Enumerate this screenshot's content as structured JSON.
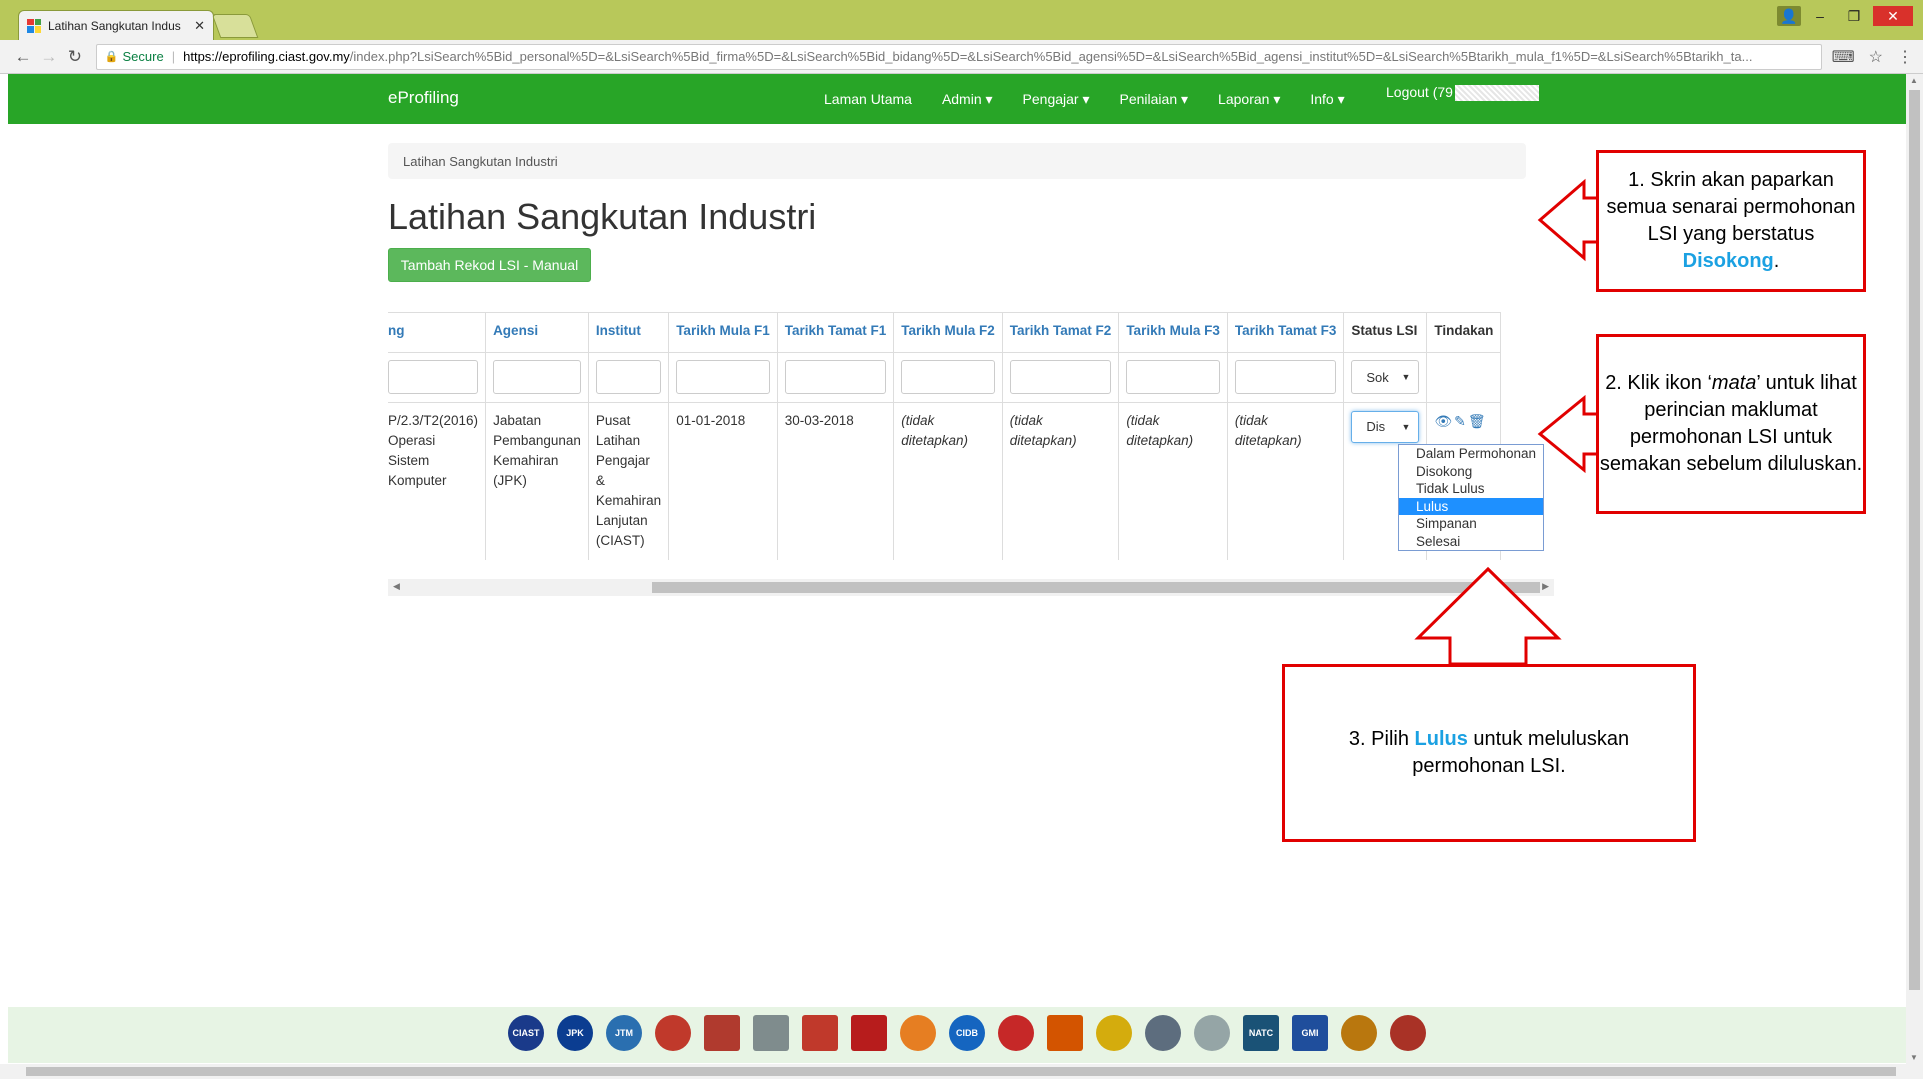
{
  "browser": {
    "tab_title": "Latihan Sangkutan Indus",
    "tab_close": "✕",
    "secure_label": "Secure",
    "url_host": "https://eprofiling.ciast.gov.my",
    "url_path": "/index.php?LsiSearch%5Bid_personal%5D=&LsiSearch%5Bid_firma%5D=&LsiSearch%5Bid_bidang%5D=&LsiSearch%5Bid_agensi%5D=&LsiSearch%5Bid_agensi_institut%5D=&LsiSearch%5Btarikh_mula_f1%5D=&LsiSearch%5Btarikh_ta..."
  },
  "navbar": {
    "brand": "eProfiling",
    "menu": [
      "Laman Utama",
      "Admin ▾",
      "Pengajar ▾",
      "Penilaian ▾",
      "Laporan ▾",
      "Info ▾"
    ],
    "logout": "Logout (79"
  },
  "breadcrumb": "Latihan Sangkutan Industri",
  "page_title": "Latihan Sangkutan Industri",
  "add_button": "Tambah Rekod LSI - Manual",
  "table": {
    "headers": [
      "ng",
      "Agensi",
      "Institut",
      "Tarikh Mula F1",
      "Tarikh Tamat F1",
      "Tarikh Mula F2",
      "Tarikh Tamat F2",
      "Tarikh Mula F3",
      "Tarikh Tamat F3",
      "Status LSI",
      "Tindakan"
    ],
    "filter_status": "Sok",
    "row": {
      "bidang": "P/2.3/T2(2016) Operasi Sistem Komputer",
      "agensi": "Jabatan Pembangunan Kemahiran (JPK)",
      "institut": "Pusat Latihan Pengajar & Kemahiran Lanjutan (CIAST)",
      "mula_f1": "01-01-2018",
      "tamat_f1": "30-03-2018",
      "mula_f2": "(tidak ditetapkan)",
      "tamat_f2": "(tidak ditetapkan)",
      "mula_f3": "(tidak ditetapkan)",
      "tamat_f3": "(tidak ditetapkan)",
      "status": "Dis"
    }
  },
  "status_options": [
    "Dalam Permohonan",
    "Disokong",
    "Tidak Lulus",
    "Lulus",
    "Simpanan",
    "Selesai"
  ],
  "status_selected_index": 3,
  "callouts": {
    "c1_text": "1. Skrin akan paparkan semua senarai permohonan LSI yang berstatus",
    "c1_hl": "Disokong",
    "c2_pre": "2. Klik ikon ‘",
    "c2_em": "mata",
    "c2_post": "’ untuk lihat perincian maklumat permohonan LSI untuk semakan sebelum diluluskan.",
    "c3_pre": "3. Pilih",
    "c3_hl": "Lulus",
    "c3_post": "untuk meluluskan permohonan LSI."
  },
  "colors": {
    "navbar": "#28a527",
    "button": "#5cb85c",
    "link": "#337ab7",
    "not_set": "#d9534f",
    "callout_border": "#e10000",
    "highlight": "#1ba1e2"
  },
  "footer_logos": [
    "CIAST",
    "JPK",
    "JTM",
    "",
    "",
    "",
    "",
    "",
    "",
    "",
    "CIDB",
    "",
    "",
    "",
    "",
    "",
    "NATC",
    "GMI",
    "",
    ""
  ]
}
